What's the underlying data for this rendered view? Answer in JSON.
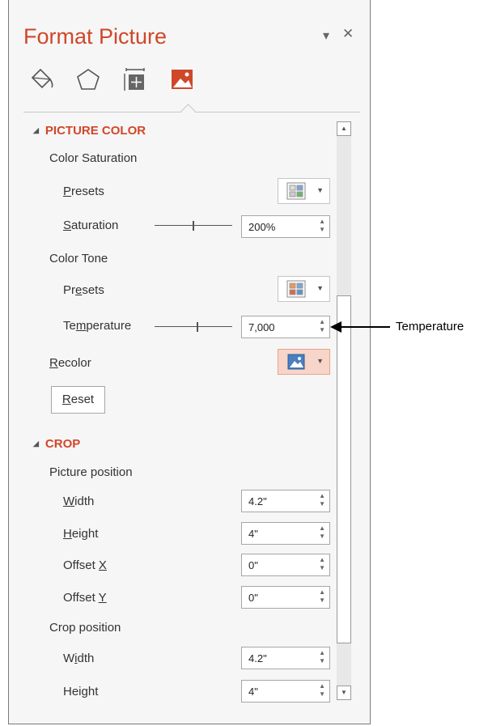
{
  "pane": {
    "title": "Format Picture",
    "dropdown_icon": "▾",
    "close_icon": "✕",
    "tabs": [
      {
        "name": "fill-line",
        "icon": "paint-bucket-icon"
      },
      {
        "name": "effects",
        "icon": "pentagon-icon"
      },
      {
        "name": "size-properties",
        "icon": "size-icon"
      },
      {
        "name": "picture",
        "icon": "picture-icon",
        "active": true
      }
    ]
  },
  "picture_color": {
    "header": "PICTURE COLOR",
    "color_saturation": "Color Saturation",
    "presets_label_u": "P",
    "presets_label_rest": "resets",
    "saturation_label_u": "S",
    "saturation_label_rest": "aturation",
    "saturation_value": "200%",
    "color_tone": "Color Tone",
    "tone_presets_a": "Pr",
    "tone_presets_u": "e",
    "tone_presets_b": "sets",
    "temperature_a": "Te",
    "temperature_u": "m",
    "temperature_b": "perature",
    "temperature_value": "7,000",
    "recolor_u": "R",
    "recolor_rest": "ecolor",
    "reset_u": "R",
    "reset_rest": "eset"
  },
  "crop": {
    "header": "CROP",
    "picture_position": "Picture position",
    "width_u": "W",
    "width_rest": "idth",
    "width_value": "4.2\"",
    "height_u": "H",
    "height_rest": "eight",
    "height_value": "4\"",
    "offset_x_a": "Offset ",
    "offset_x_u": "X",
    "offset_x_value": "0\"",
    "offset_y_a": "Offset ",
    "offset_y_u": "Y",
    "offset_y_value": "0\"",
    "crop_position": "Crop position",
    "crop_width_a": "W",
    "crop_width_u": "i",
    "crop_width_b": "dth",
    "crop_width_value": "4.2\"",
    "crop_height_a": "Hei",
    "crop_height_u": "g",
    "crop_height_b": "ht",
    "crop_height_value": "4\""
  },
  "callout": {
    "label": "Temperature"
  },
  "colors": {
    "accent": "#d0472a",
    "active_fill": "#f7d5c8"
  }
}
